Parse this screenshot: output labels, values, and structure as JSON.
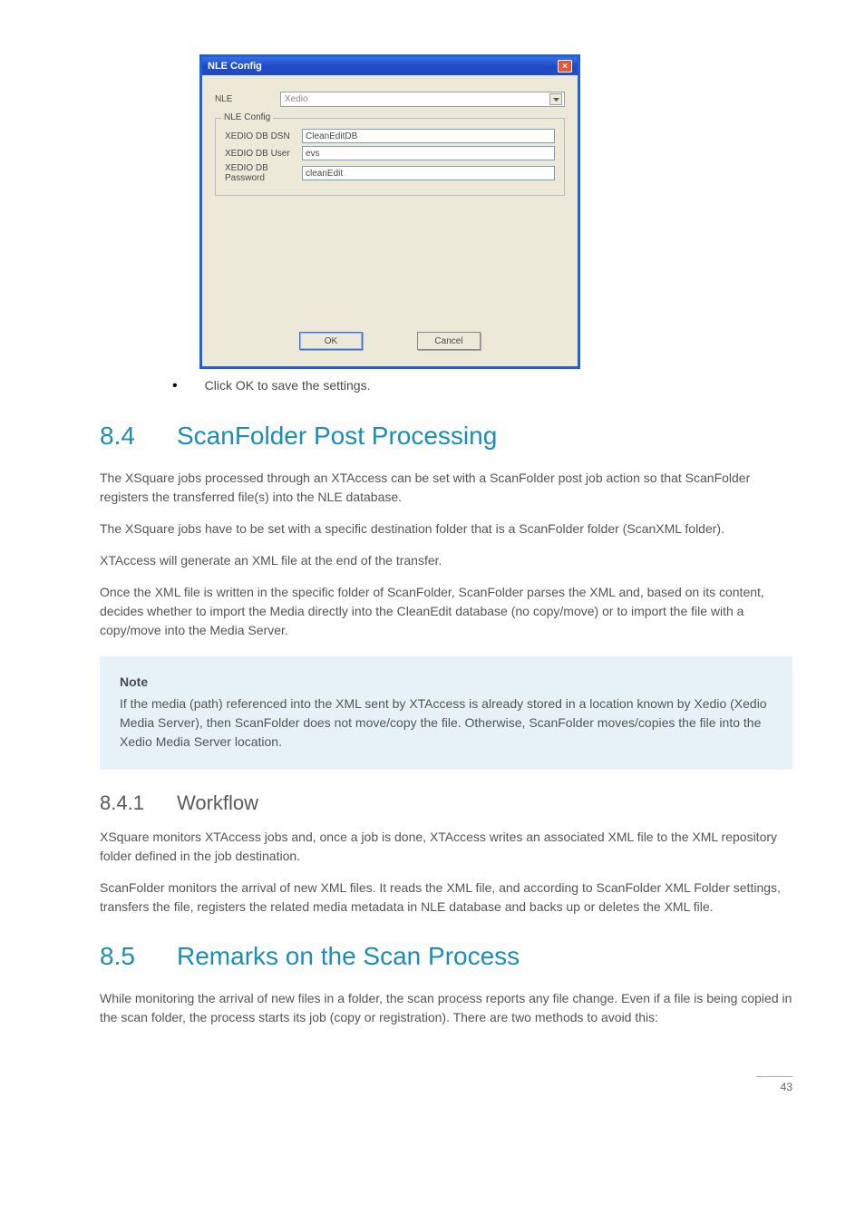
{
  "dialog": {
    "title": "NLE Config",
    "close_label": "×",
    "nle_label": "NLE",
    "nle_value": "Xedio",
    "fieldset_title": "NLE Config",
    "fields": {
      "dsn_label": "XEDIO DB DSN",
      "dsn_value": "CleanEditDB",
      "user_label": "XEDIO DB User",
      "user_value": "evs",
      "pw_label": "XEDIO DB Password",
      "pw_value": "cleanEdit"
    },
    "ok": "OK",
    "cancel": "Cancel"
  },
  "bullet1": "Click OK to save the settings.",
  "section_84": {
    "num": "8.4",
    "title": "ScanFolder Post Processing",
    "p1": "The XSquare jobs processed through an XTAccess can be set with a ScanFolder post job action so that ScanFolder registers the transferred file(s) into the NLE database.",
    "p2": "The XSquare jobs have to be set with a specific destination folder that is a ScanFolder folder (ScanXML folder).",
    "p3": "XTAccess will generate an XML file at the end of the transfer.",
    "p4": "Once the XML file is written in the specific folder of ScanFolder, ScanFolder parses the XML and, based on its content, decides whether to import the Media directly into the CleanEdit database (no copy/move) or to import the file with a copy/move into the Media Server.",
    "note_head": "Note",
    "note_body": "If the media (path) referenced into the XML sent by XTAccess is already stored in a location known by Xedio (Xedio Media Server), then ScanFolder does not move/copy the file. Otherwise, ScanFolder moves/copies the file into the Xedio Media Server location."
  },
  "section_841": {
    "num": "8.4.1",
    "title": "Workflow",
    "p1": "XSquare monitors XTAccess jobs and, once a job is done, XTAccess writes an associated XML file to the XML repository folder defined in the job destination.",
    "p2": "ScanFolder monitors the arrival of new XML files. It reads the XML file, and according to ScanFolder XML Folder settings, transfers the file, registers the related media metadata in NLE database and backs up or deletes the XML file."
  },
  "section_85": {
    "num": "8.5",
    "title": "Remarks on the Scan Process",
    "p1": "While monitoring the arrival of new files in a folder, the scan process reports any file change. Even if a file is being copied in the scan folder, the process starts its job (copy or registration). There are two methods to avoid this:"
  },
  "page_number": "43"
}
